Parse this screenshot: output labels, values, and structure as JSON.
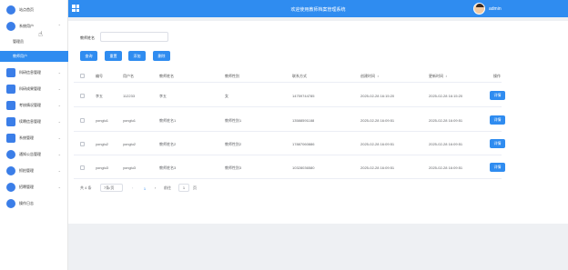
{
  "header": {
    "title": "欢迎使用教师档案管理系统",
    "user_name": "admin"
  },
  "sidebar": {
    "items": [
      {
        "label": "站点首页"
      },
      {
        "label": "系统用户"
      },
      {
        "label": "科研信息管理"
      },
      {
        "label": "科研成果管理"
      },
      {
        "label": "考核情况管理"
      },
      {
        "label": "续聘信息管理"
      },
      {
        "label": "系统管理"
      },
      {
        "label": "通知公告管理"
      },
      {
        "label": "抓拍管理"
      },
      {
        "label": "招聘管理"
      },
      {
        "label": "操作日志"
      }
    ],
    "submenu": [
      {
        "label": "管理员"
      },
      {
        "label": "教师用户"
      }
    ]
  },
  "search": {
    "label": "教师姓名",
    "placeholder": ""
  },
  "toolbar": {
    "query": "查询",
    "reset": "重置",
    "add": "添加",
    "delete": "删除"
  },
  "table": {
    "headers": [
      "编号",
      "用户名",
      "教师姓名",
      "教师性别",
      "联系方式",
      "创建时间",
      "更新时间",
      "操作"
    ],
    "detail_label": "详情",
    "rows": [
      {
        "id": "李五",
        "username": "112233",
        "name": "李五",
        "gender": "女",
        "phone": "14759744785",
        "created": "2025-02-28 16:15:20",
        "updated": "2025-02-28 16:15:20"
      },
      {
        "id": "yonglu1",
        "username": "yonglu1",
        "name": "教师姓名1",
        "gender": "教师性别1",
        "phone": "13588591188",
        "created": "2025-02-28 16:09:51",
        "updated": "2025-02-28 16:09:51"
      },
      {
        "id": "yonglu2",
        "username": "yonglu2",
        "name": "教师姓名2",
        "gender": "教师性别2",
        "phone": "17887060886",
        "created": "2025-02-28 16:09:51",
        "updated": "2025-02-28 16:09:51"
      },
      {
        "id": "yonglu3",
        "username": "yonglu3",
        "name": "教师姓名3",
        "gender": "教师性别3",
        "phone": "10328036580",
        "created": "2025-02-28 16:09:51",
        "updated": "2025-02-28 16:09:51"
      }
    ]
  },
  "pagination": {
    "total": "共 4 条",
    "page_size": "7条/页",
    "prev": "‹",
    "current": "1",
    "next": "›",
    "goto_label": "前往",
    "goto_value": "1",
    "page_unit": "页"
  },
  "colors": {
    "accent": "#2f8cf0"
  },
  "icons": [
    "home-icon",
    "user-icon",
    "grid-icon",
    "chevron-down-icon",
    "sort-icon"
  ]
}
